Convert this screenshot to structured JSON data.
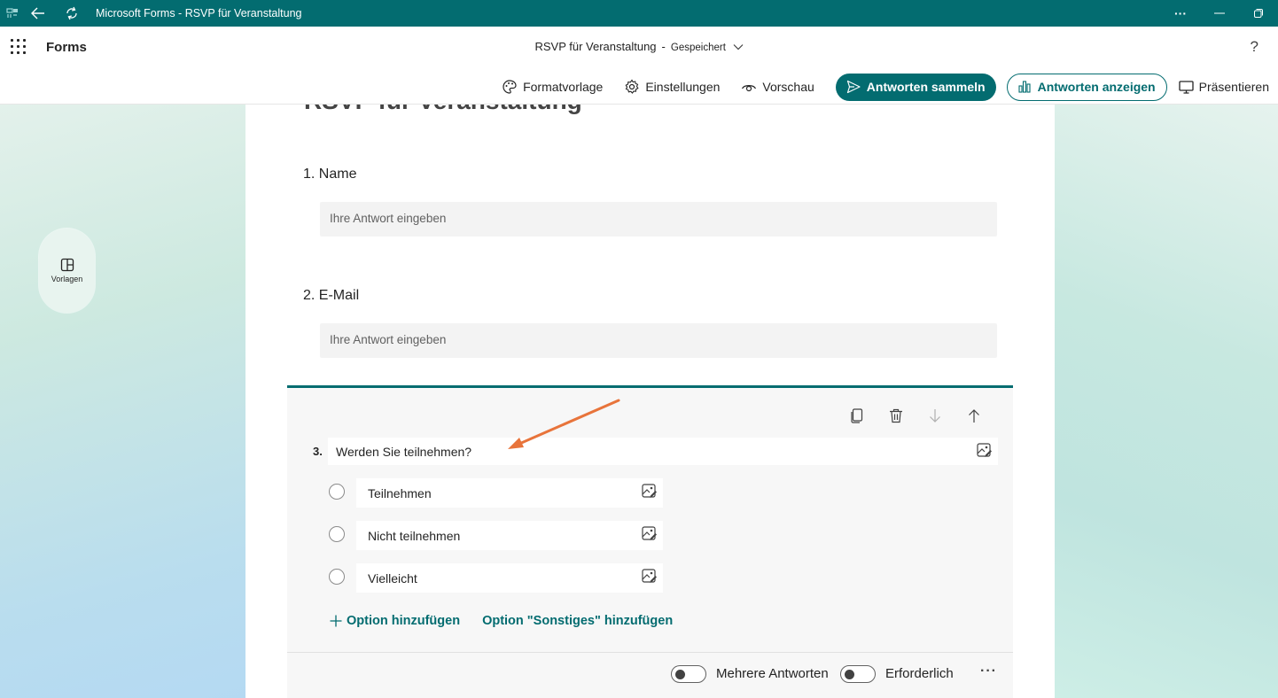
{
  "window": {
    "title": "Microsoft Forms - RSVP für Veranstaltung",
    "more": "···"
  },
  "app": {
    "name": "Forms",
    "doc_title": "RSVP für Veranstaltung",
    "separator": "-",
    "saved_status": "Gespeichert",
    "help": "?"
  },
  "toolbar": {
    "style": "Formatvorlage",
    "settings": "Einstellungen",
    "preview": "Vorschau",
    "collect": "Antworten sammeln",
    "view_responses": "Antworten anzeigen",
    "present": "Präsentieren"
  },
  "side": {
    "templates": "Vorlagen"
  },
  "form": {
    "title": "RSVP für Veranstaltung",
    "questions": [
      {
        "number": "1.",
        "label": "Name",
        "placeholder": "Ihre Antwort eingeben"
      },
      {
        "number": "2.",
        "label": "E-Mail",
        "placeholder": "Ihre Antwort eingeben"
      }
    ],
    "active_question": {
      "number": "3.",
      "text": "Werden Sie teilnehmen?",
      "options": [
        "Teilnehmen",
        "Nicht teilnehmen",
        "Vielleicht"
      ],
      "add_option": "Option hinzufügen",
      "add_other": "Option \"Sonstiges\" hinzufügen",
      "multiple_answers": "Mehrere Antworten",
      "required": "Erforderlich",
      "more": "···"
    }
  },
  "colors": {
    "accent": "#036c70",
    "annotation_arrow": "#e8743b"
  }
}
